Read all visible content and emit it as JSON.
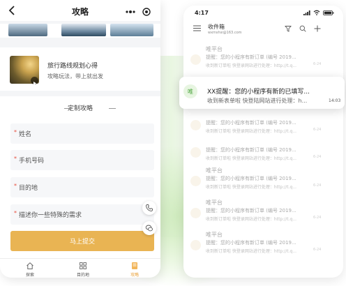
{
  "left_app": {
    "nav_title": "攻略",
    "article": {
      "title": "旅行路线规划心得",
      "subtitle": "攻略玩法，带上就出发"
    },
    "form": {
      "heading": "定制攻略",
      "fields": [
        {
          "label": "姓名",
          "required": true
        },
        {
          "label": "手机号码",
          "required": true
        },
        {
          "label": "目的地",
          "required": true
        },
        {
          "label": "描述你一些特殊的需求",
          "required": true
        }
      ],
      "submit_label": "马上提交"
    },
    "tabs": [
      {
        "label": "探索",
        "icon": "home-icon"
      },
      {
        "label": "目的地",
        "icon": "grid-icon"
      },
      {
        "label": "攻略",
        "icon": "guide-icon",
        "active": true
      }
    ],
    "accent_color": "#e9b453"
  },
  "mail_app": {
    "status_time": "4:17",
    "inbox_title": "收件箱",
    "account": "wxmshsi@163.com",
    "notification": {
      "avatar_char": "唯",
      "title": "XX提醒：您的小程序有新的已填写...",
      "preview": "收到新表单啦 快登陆网站进行处理：h...",
      "time": "14:03"
    },
    "rows": [
      {
        "sender": "唯平台",
        "subject": "提醒：您的小程序有新订单 (编号 2019...",
        "preview": "收到新订单啦 快登录网站进行处理：http://t.q...",
        "time": "6-24"
      },
      {
        "sender": "",
        "subject": "提醒：您的小程序有新订单 (编号 2019...",
        "preview": "收到新订单啦 快登录网站进行处理：http://t.q...",
        "time": "6-24"
      },
      {
        "sender": "",
        "subject": "提醒：您的小程序有新订单 (编号 2019...",
        "preview": "收到新订单啦 快登录网站进行处理：http://t.q...",
        "time": "6-24"
      },
      {
        "sender": "唯平台",
        "subject": "提醒：您的小程序有新订单 (编号 2019...",
        "preview": "收到新订单啦 快登录网站进行处理：http://t.q...",
        "time": "6-24"
      },
      {
        "sender": "唯平台",
        "subject": "提醒：您的小程序有新订单 (编号 2019...",
        "preview": "收到新订单啦 快登录网站进行处理：http://t.q...",
        "time": "6-24"
      },
      {
        "sender": "唯平台",
        "subject": "提醒：您的小程序有新订单 (编号 2019...",
        "preview": "收到新订单啦 快登录网站进行处理：http://t.q...",
        "time": "6-24"
      }
    ]
  }
}
